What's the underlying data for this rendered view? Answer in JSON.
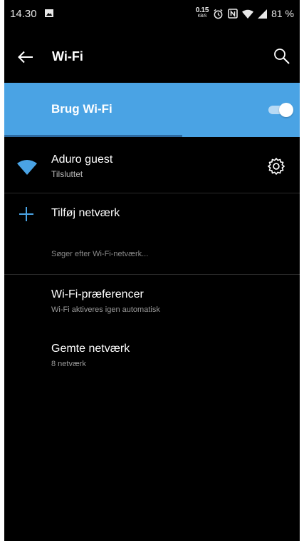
{
  "status_bar": {
    "time": "14.30",
    "speed_value": "0.15",
    "speed_unit": "KB/S",
    "battery": "81 %"
  },
  "app_bar": {
    "title": "Wi-Fi"
  },
  "wifi_toggle": {
    "label": "Brug Wi-Fi",
    "enabled": true,
    "accent_color": "#4aa3e4"
  },
  "connected_network": {
    "name": "Aduro guest",
    "status": "Tilsluttet"
  },
  "add_network": {
    "label": "Tilføj netværk"
  },
  "scan_status": "Søger efter Wi-Fi-netværk...",
  "settings_items": [
    {
      "title": "Wi-Fi-præferencer",
      "subtitle": "Wi-Fi aktiveres igen automatisk"
    },
    {
      "title": "Gemte netværk",
      "subtitle": "8 netværk"
    }
  ],
  "icons": {
    "back": "arrow-left-icon",
    "search": "search-icon",
    "wifi": "wifi-signal-icon",
    "settings": "gear-icon",
    "add": "plus-icon"
  }
}
